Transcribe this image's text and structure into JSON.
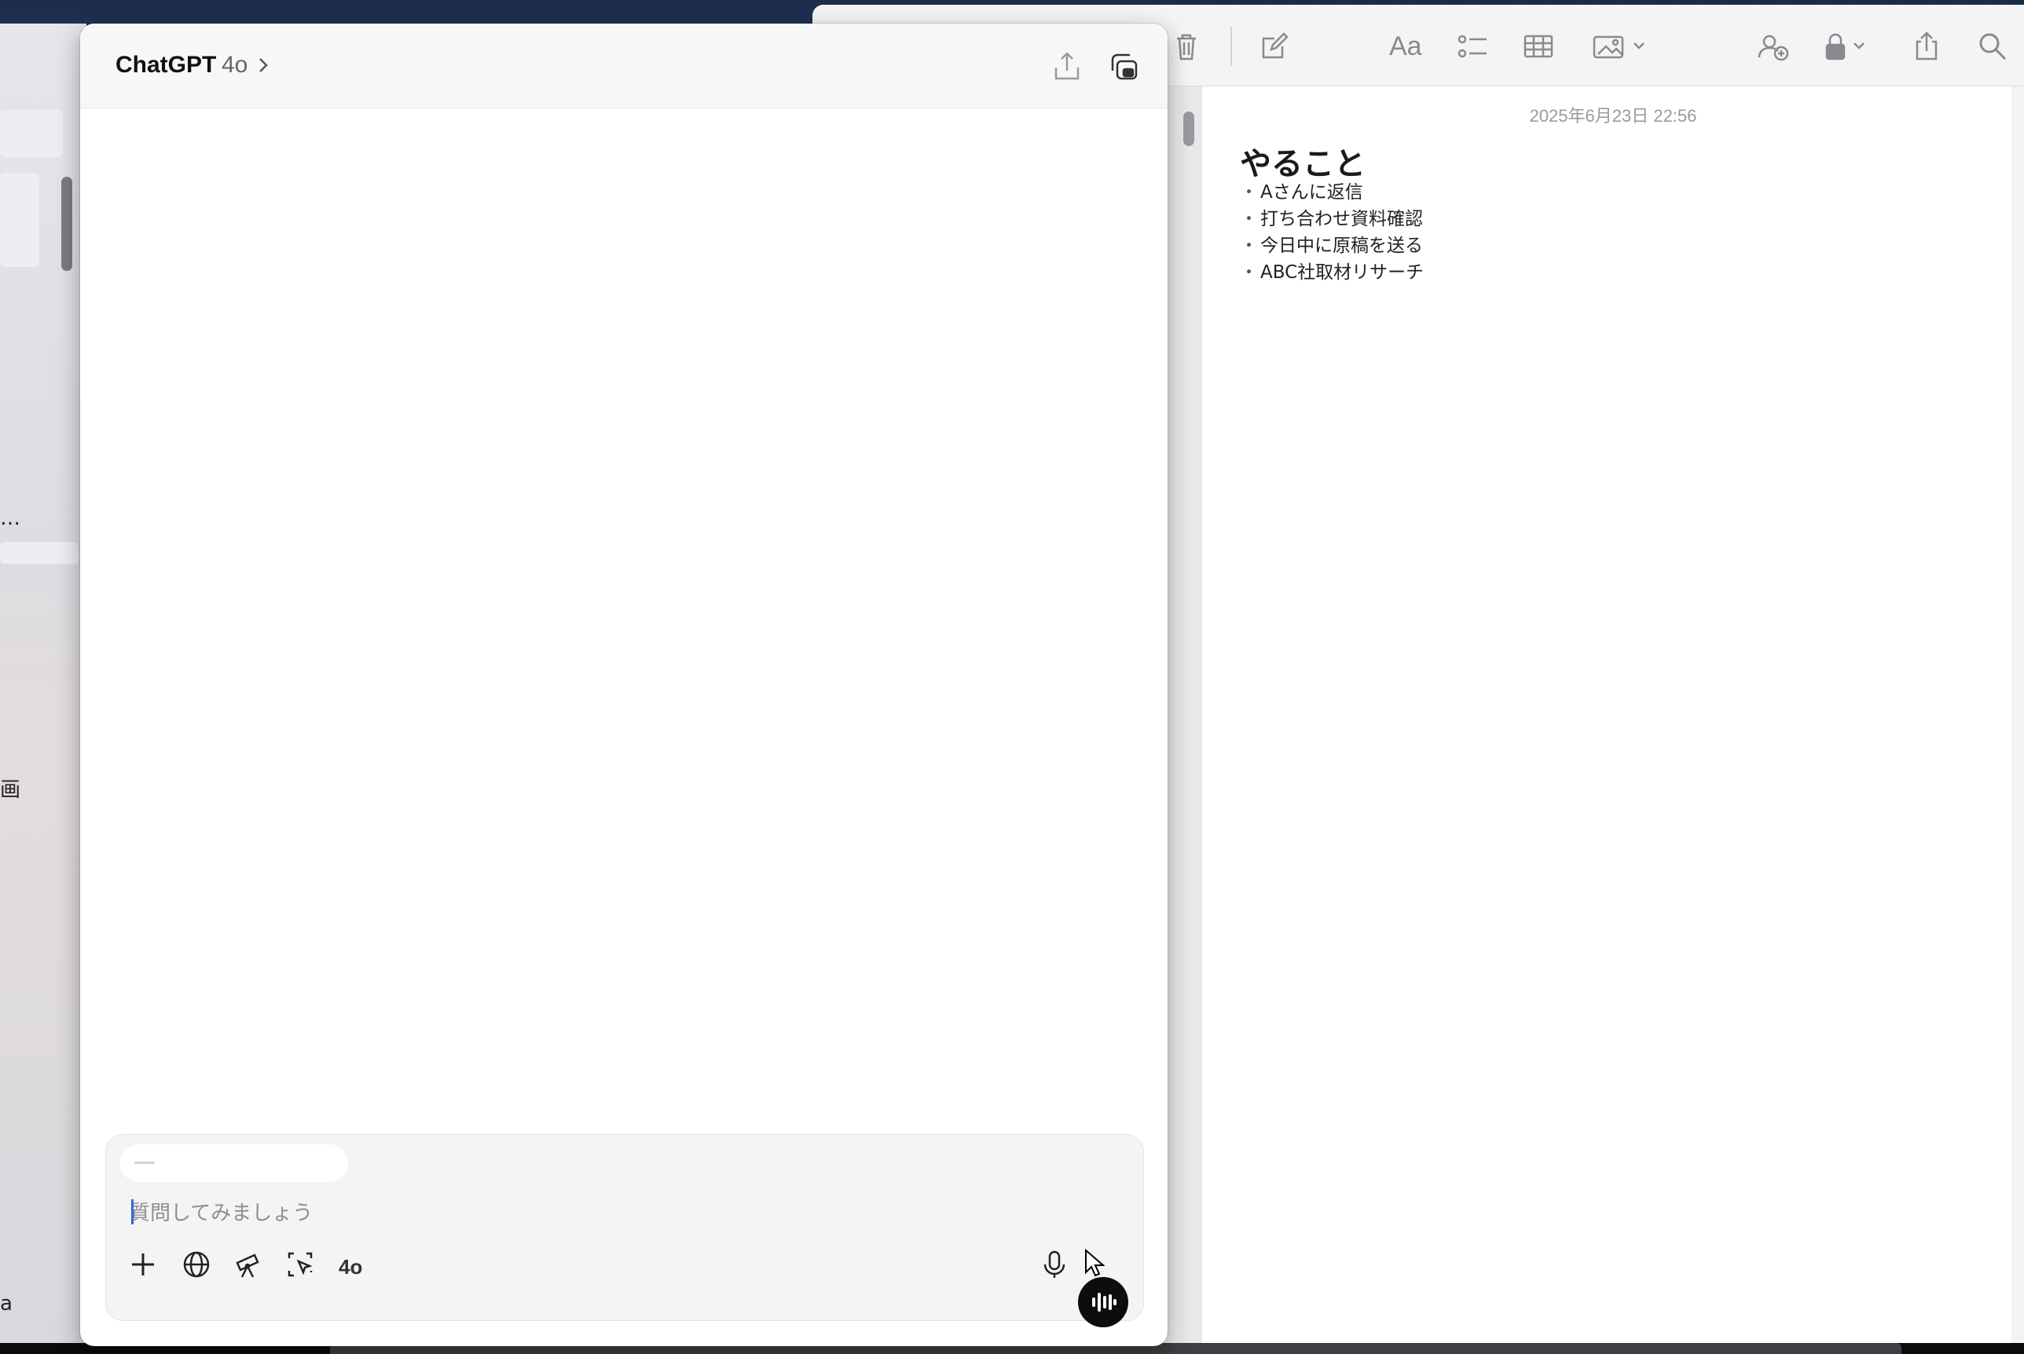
{
  "chatgpt": {
    "title": "ChatGPT",
    "model": "4o",
    "share_icon": "share-icon",
    "new_window_icon": "new-window-icon",
    "composer": {
      "placeholder": "質問してみましょう",
      "value": "",
      "tools": [
        "plus-icon",
        "globe-icon",
        "telescope-icon",
        "screen-select-icon"
      ],
      "model_label": "4o",
      "mic_icon": "mic-icon",
      "voice_icon": "voice-waveform-icon"
    }
  },
  "background_app": {
    "fragments": [
      "…",
      "画",
      "a"
    ]
  },
  "notes": {
    "toolbar": [
      "trash-icon",
      "compose-icon",
      "format-icon",
      "checklist-icon",
      "table-icon",
      "media-icon",
      "collaborate-icon",
      "lock-icon",
      "share-icon",
      "search-icon"
    ],
    "format_label": "Aa",
    "date": "2025年6月23日 22:56",
    "title": "やること",
    "bullet": "・",
    "items": [
      "Aさんに返信",
      "打ち合わせ資料確認",
      "今日中に原稿を送る",
      "ABC社取材リサーチ"
    ]
  }
}
